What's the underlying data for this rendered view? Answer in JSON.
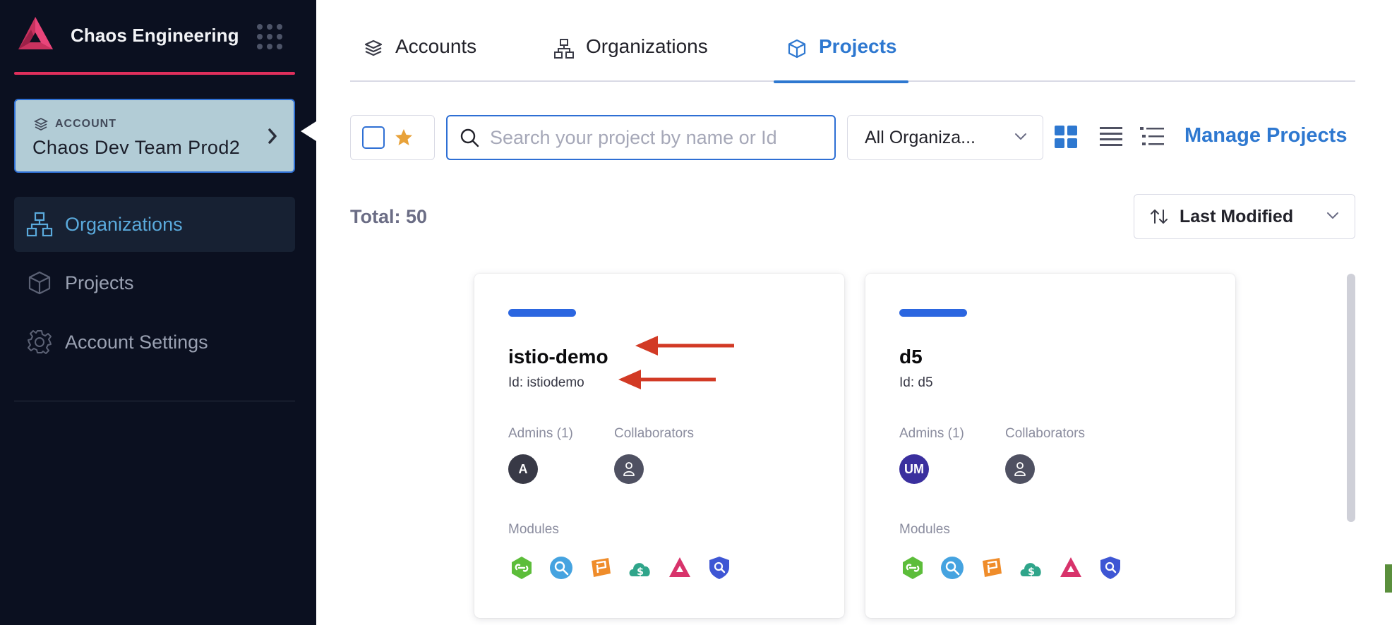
{
  "brand": {
    "title": "Chaos Engineering"
  },
  "account": {
    "label": "ACCOUNT",
    "name": "Chaos Dev Team Prod2"
  },
  "sidebar": {
    "items": [
      {
        "label": "Organizations",
        "active": true,
        "icon": "org-hierarchy-icon"
      },
      {
        "label": "Projects",
        "active": false,
        "icon": "cube-icon"
      },
      {
        "label": "Account Settings",
        "active": false,
        "icon": "gear-icon"
      }
    ]
  },
  "tabs": [
    {
      "label": "Accounts",
      "icon": "layers-icon"
    },
    {
      "label": "Organizations",
      "icon": "org-hierarchy-icon"
    },
    {
      "label": "Projects",
      "icon": "cube-icon",
      "active": true
    }
  ],
  "toolbar": {
    "search_placeholder": "Search your project by name or Id",
    "org_filter": "All Organiza...",
    "manage_label": "Manage Projects"
  },
  "summary": {
    "total": "Total: 50",
    "sort": "Last Modified"
  },
  "projects": [
    {
      "name": "istio-demo",
      "id": "Id: istiodemo",
      "admins_label": "Admins (1)",
      "admin_initials": "A",
      "admin_color": "#383946",
      "collaborators_label": "Collaborators",
      "modules_label": "Modules"
    },
    {
      "name": "d5",
      "id": "Id: d5",
      "admins_label": "Admins (1)",
      "admin_initials": "UM",
      "admin_color": "#3a2f9e",
      "collaborators_label": "Collaborators",
      "modules_label": "Modules"
    }
  ],
  "modules": [
    "ci-module-icon",
    "srm-module-icon",
    "ff-module-icon",
    "ccm-module-icon",
    "chaos-module-icon",
    "sto-module-icon"
  ],
  "colors": {
    "accent": "#2e78d0",
    "sidebar_bg": "#0b1020",
    "brand": "#e02f5c",
    "annotation_arrow": "#d23a25"
  }
}
